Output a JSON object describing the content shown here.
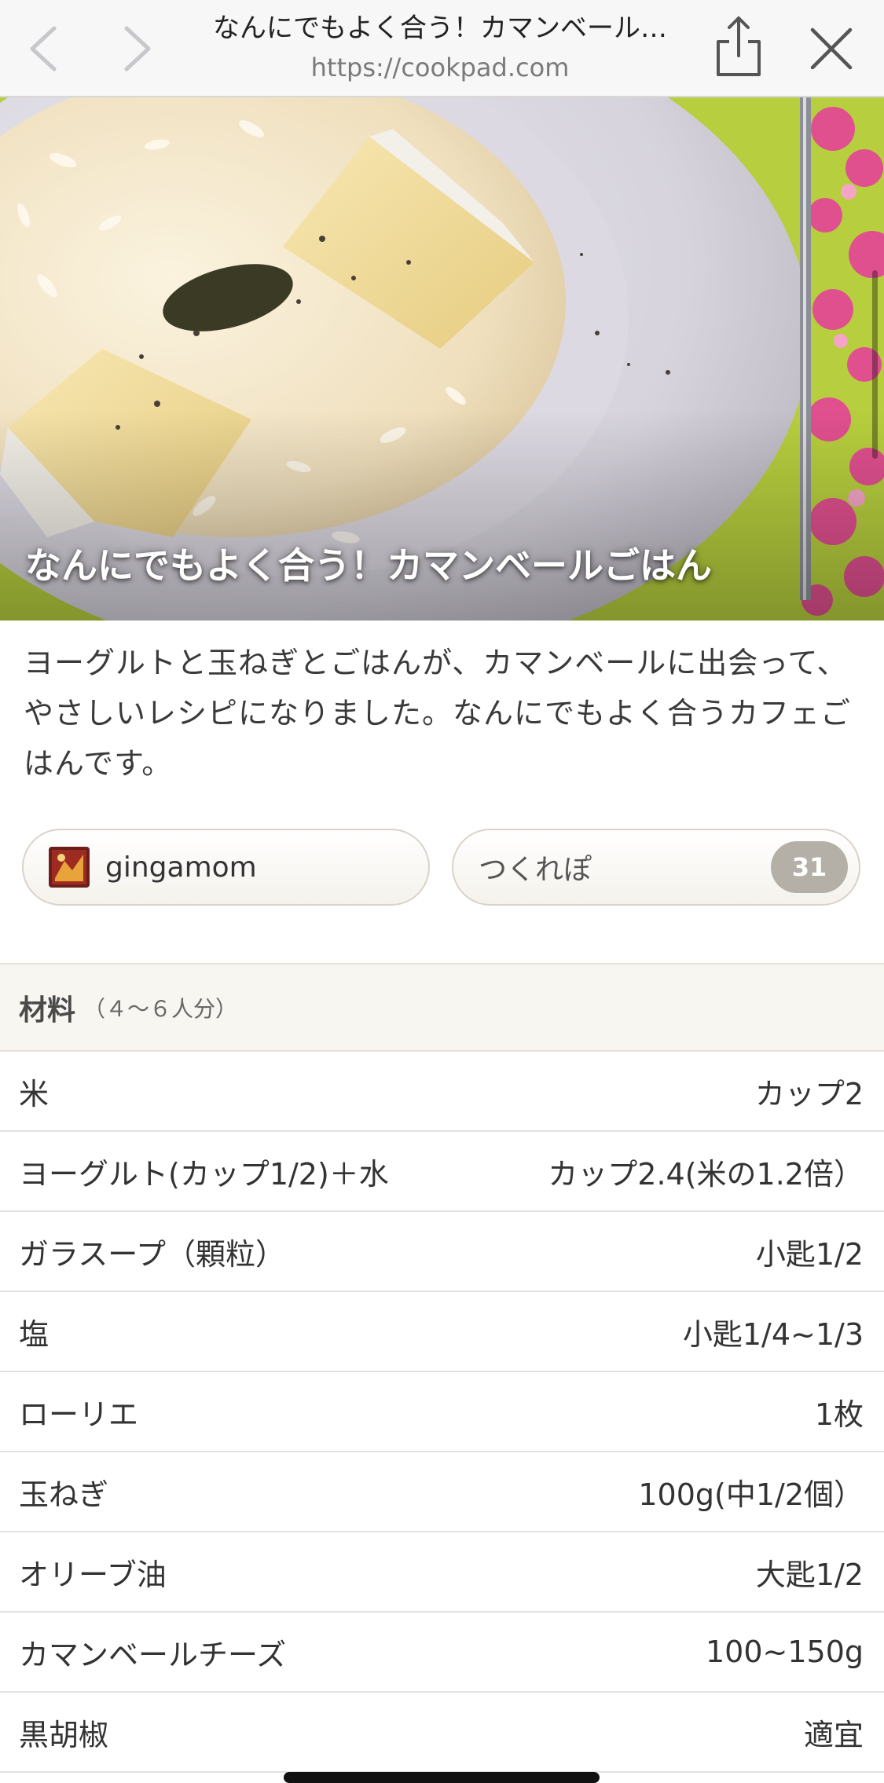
{
  "browser": {
    "title": "なんにでもよく合う！カマンベール…",
    "url": "https://cookpad.com",
    "icons": {
      "back": "chevron-left-icon",
      "forward": "chevron-right-icon",
      "share": "share-icon",
      "close": "close-icon"
    }
  },
  "recipe": {
    "caption": "なんにでもよく合う！カマンベールごはん",
    "description": "ヨーグルトと玉ねぎとごはんが、カマンベールに出会って、やさしいレシピになりました。なんにでもよく合うカフェごはんです。",
    "author": "gingamom",
    "tsukurepo_label": "つくれぽ",
    "tsukurepo_count": "31"
  },
  "ingredients": {
    "title": "材料",
    "servings": "（４〜６人分）",
    "items": [
      {
        "name": "米",
        "qty": "カップ2"
      },
      {
        "name": "ヨーグルト(カップ1/2)＋水",
        "qty": "カップ2.4(米の1.2倍）"
      },
      {
        "name": "ガラスープ（顆粒）",
        "qty": "小匙1/2"
      },
      {
        "name": "塩",
        "qty": "小匙1/4~1/3"
      },
      {
        "name": "ローリエ",
        "qty": "1枚"
      },
      {
        "name": "玉ねぎ",
        "qty": "100g(中1/2個）"
      },
      {
        "name": "オリーブ油",
        "qty": "大匙1/2"
      },
      {
        "name": "カマンベールチーズ",
        "qty": "100~150g"
      },
      {
        "name": "黒胡椒",
        "qty": "適宜"
      }
    ]
  },
  "colors": {
    "topbar_bg": "#f7f7f7",
    "header_bg": "#f8f6f0",
    "badge_bg": "#b5b0a7",
    "nav_inactive": "#c7c7cc",
    "nav_active": "#555555"
  }
}
